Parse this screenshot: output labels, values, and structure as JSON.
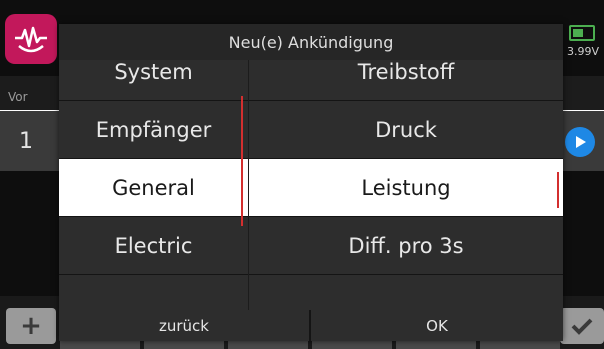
{
  "dialog": {
    "title": "Neu(e) Ankündigung",
    "categories": [
      {
        "label": "System"
      },
      {
        "label": "Empfänger"
      },
      {
        "label": "General",
        "selected": true
      },
      {
        "label": "Electric"
      },
      {
        "label": ""
      }
    ],
    "items": [
      {
        "label": "Treibstoff"
      },
      {
        "label": "Druck"
      },
      {
        "label": "Leistung",
        "selected": true
      },
      {
        "label": "Diff. pro 3s"
      },
      {
        "label": ""
      }
    ],
    "back_label": "zurück",
    "ok_label": "OK"
  },
  "background": {
    "voltage": "3.99V",
    "tab_label": "Vor",
    "row_number": "1",
    "add_label": "+"
  },
  "colors": {
    "accent": "#d32f2f",
    "app_icon": "#c2185b",
    "play": "#1e88e5",
    "battery": "#4caf50"
  }
}
